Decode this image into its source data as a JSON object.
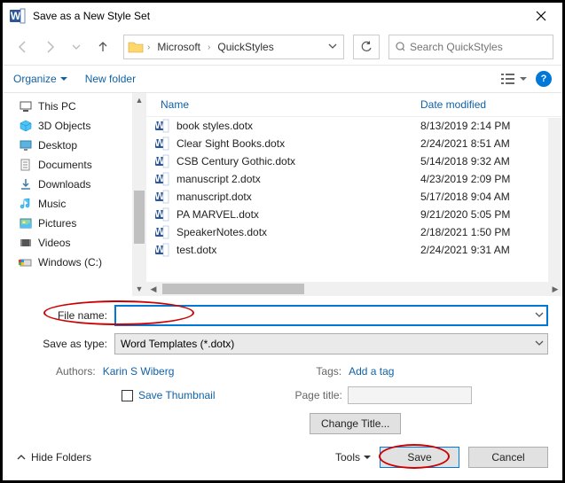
{
  "title": "Save as a New Style Set",
  "breadcrumbs": [
    "Microsoft",
    "QuickStyles"
  ],
  "search": {
    "placeholder": "Search QuickStyles"
  },
  "toolbar": {
    "organize": "Organize",
    "newfolder": "New folder"
  },
  "columns": {
    "name": "Name",
    "date": "Date modified"
  },
  "tree": [
    {
      "label": "This PC",
      "icon": "pc"
    },
    {
      "label": "3D Objects",
      "icon": "3d"
    },
    {
      "label": "Desktop",
      "icon": "desktop"
    },
    {
      "label": "Documents",
      "icon": "docs"
    },
    {
      "label": "Downloads",
      "icon": "downloads"
    },
    {
      "label": "Music",
      "icon": "music"
    },
    {
      "label": "Pictures",
      "icon": "pictures"
    },
    {
      "label": "Videos",
      "icon": "videos"
    },
    {
      "label": "Windows (C:)",
      "icon": "drive"
    }
  ],
  "files": [
    {
      "name": "book styles.dotx",
      "date": "8/13/2019 2:14 PM"
    },
    {
      "name": "Clear Sight Books.dotx",
      "date": "2/24/2021 8:51 AM"
    },
    {
      "name": "CSB Century Gothic.dotx",
      "date": "5/14/2018 9:32 AM"
    },
    {
      "name": "manuscript 2.dotx",
      "date": "4/23/2019 2:09 PM"
    },
    {
      "name": "manuscript.dotx",
      "date": "5/17/2018 9:04 AM"
    },
    {
      "name": "PA MARVEL.dotx",
      "date": "9/21/2020 5:05 PM"
    },
    {
      "name": "SpeakerNotes.dotx",
      "date": "2/18/2021 1:50 PM"
    },
    {
      "name": "test.dotx",
      "date": "2/24/2021 9:31 AM"
    }
  ],
  "form": {
    "filename_label": "File name:",
    "filename_value": "",
    "type_label": "Save as type:",
    "type_value": "Word Templates (*.dotx)",
    "authors_label": "Authors:",
    "authors_value": "Karin S Wiberg",
    "tags_label": "Tags:",
    "tags_value": "Add a tag",
    "save_thumbnail": "Save Thumbnail",
    "page_title_label": "Page title:",
    "change_title": "Change Title..."
  },
  "footer": {
    "hide": "Hide Folders",
    "tools": "Tools",
    "save": "Save",
    "cancel": "Cancel"
  }
}
